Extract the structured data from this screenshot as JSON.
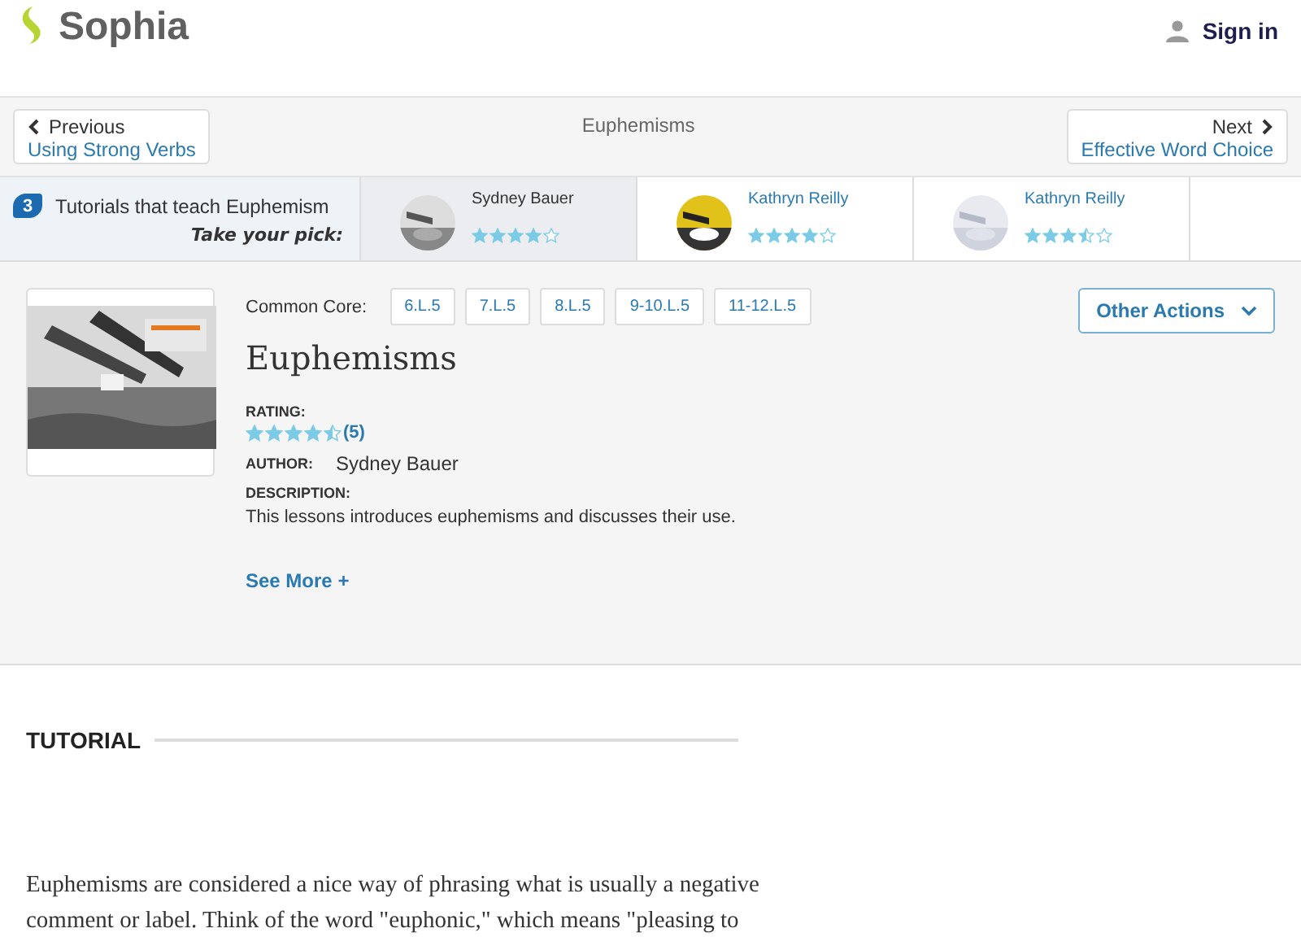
{
  "header": {
    "logo": "Sophia",
    "sign_in": "Sign in"
  },
  "nav": {
    "previous": {
      "label": "Previous",
      "title": "Using Strong Verbs"
    },
    "current": "Euphemisms",
    "next": {
      "label": "Next",
      "title": "Effective Word Choice"
    }
  },
  "tutorials_strip": {
    "count": "3",
    "label": "Tutorials that teach Euphemism",
    "pick": "Take your pick:",
    "items": [
      {
        "author": "Sydney Bauer",
        "stars": 4,
        "selected": true
      },
      {
        "author": "Kathryn Reilly",
        "stars": 4,
        "selected": false
      },
      {
        "author": "Kathryn Reilly",
        "stars": 3.5,
        "selected": false
      }
    ]
  },
  "lesson": {
    "common_core_label": "Common Core:",
    "standards": [
      "6.L.5",
      "7.L.5",
      "8.L.5",
      "9-10.L.5",
      "11-12.L.5"
    ],
    "other_actions": "Other Actions",
    "title": "Euphemisms",
    "rating_label": "RATING:",
    "stars": 4.5,
    "rating_count": "(5)",
    "author_label": "AUTHOR:",
    "author": "Sydney Bauer",
    "description_label": "DESCRIPTION:",
    "description": "This lessons introduces euphemisms and discusses their use.",
    "see_more": "See More +"
  },
  "tutorial": {
    "heading": "TUTORIAL",
    "body": "Euphemisms are considered a nice way of phrasing what is usually a negative comment or label. Think of the word \"euphonic,\" which means \"pleasing to"
  }
}
